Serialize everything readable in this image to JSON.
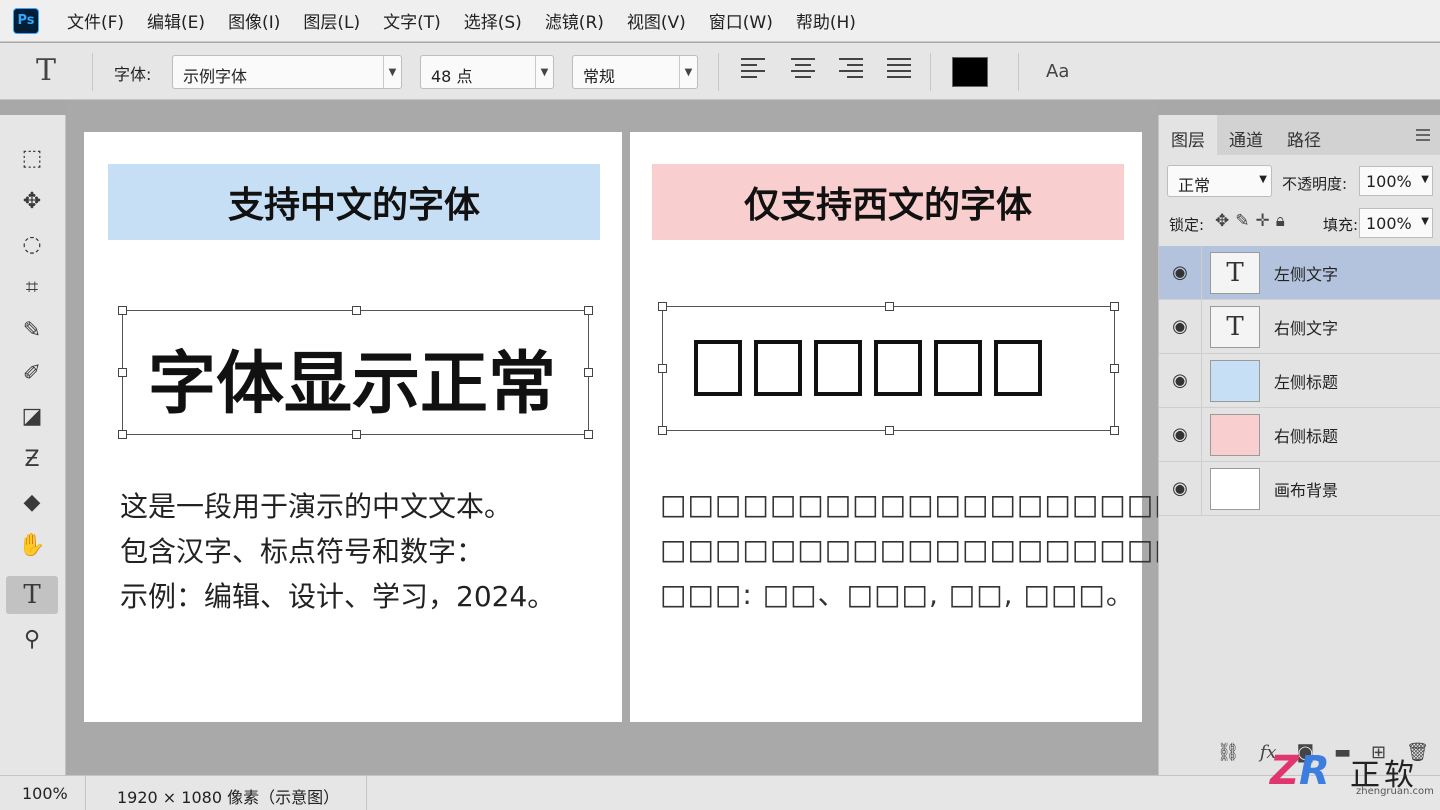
{
  "app": {
    "logo": "Ps"
  },
  "menu": [
    "文件(F)",
    "编辑(E)",
    "图像(I)",
    "图层(L)",
    "文字(T)",
    "选择(S)",
    "滤镜(R)",
    "视图(V)",
    "窗口(W)",
    "帮助(H)"
  ],
  "options": {
    "tool_glyph": "T",
    "font_label": "字体:",
    "font_family": "示例字体",
    "font_size": "48 点",
    "font_style": "常规",
    "text_color": "#000000",
    "case_toggle": "Aa"
  },
  "tools": [
    "marquee-icon",
    "move-icon",
    "lasso-icon",
    "crop-icon",
    "eyedropper-icon",
    "brush-icon",
    "eraser-icon",
    "smudge-icon",
    "paint-bucket-icon",
    "hand-icon",
    "type-icon",
    "zoom-icon"
  ],
  "canvas": {
    "left": {
      "header": "支持中文的字体",
      "header_color": "#c7dff5",
      "big_text": "字体显示正常",
      "paragraph": "这是一段用于演示的中文文本。\n包含汉字、标点符号和数字：\n示例：编辑、设计、学习，2024。"
    },
    "right": {
      "header": "仅支持西文的字体",
      "header_color": "#f8cfce",
      "paragraph": "□□□□□□□□□□□□□□□□□□□□。\n□□□□□□□□□□□□□□□□□□□□:\n□□□: □□、□□□, □□, □□□。"
    }
  },
  "layers_panel": {
    "tabs": [
      "图层",
      "通道",
      "路径"
    ],
    "blend_mode": "正常",
    "opacity_label": "不透明度:",
    "opacity": "100%",
    "lock_label": "锁定:",
    "fill_label": "填充:",
    "fill": "100%",
    "layers": [
      {
        "name": "左侧文字",
        "thumb": "T",
        "selected": true
      },
      {
        "name": "右侧文字",
        "thumb": "T",
        "selected": false
      },
      {
        "name": "左侧标题",
        "thumb": "",
        "color": "#c7dff5",
        "selected": false
      },
      {
        "name": "右侧标题",
        "thumb": "",
        "color": "#f8cfce",
        "selected": false
      },
      {
        "name": "画布背景",
        "thumb": "",
        "color": "#ffffff",
        "selected": false
      }
    ]
  },
  "status": {
    "zoom": "100%",
    "doc_info": "1920 × 1080 像素（示意图）"
  },
  "watermark": {
    "logo": "ZR",
    "name": "正软",
    "url": "zhengruan.com"
  }
}
